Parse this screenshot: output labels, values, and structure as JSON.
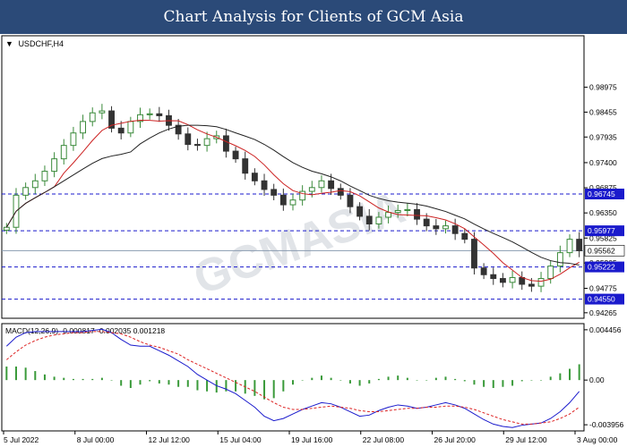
{
  "header": {
    "title": "Chart Analysis for Clients of GCM Asia"
  },
  "symbol": "USDCHF,H4",
  "watermark": "GCMASIA",
  "colors": {
    "banner": "#2b4a78",
    "bull": "#3a8a3a",
    "bear": "#333333",
    "ma_fast": "#cc2222",
    "ma_slow": "#222222",
    "level": "#1a1acc",
    "price_line": "#8a9bb0",
    "macd": "#1a1acc",
    "signal": "#dd2222",
    "hist": "#3a9a3a"
  },
  "chart_data": [
    {
      "type": "candlestick",
      "title": "USDCHF,H4",
      "ylim": [
        0.9415,
        1.0005
      ],
      "y_ticks": [
        "0.98975",
        "0.98455",
        "0.97935",
        "0.97400",
        "0.96875",
        "0.96350",
        "0.95825",
        "0.95305",
        "0.94775",
        "0.94265"
      ],
      "x_ticks": [
        "5 Jul 2022",
        "8 Jul 00:00",
        "12 Jul 12:00",
        "15 Jul 04:00",
        "19 Jul 16:00",
        "22 Jul 08:00",
        "26 Jul 20:00",
        "29 Jul 12:00",
        "3 Aug 00:00"
      ],
      "support_resistance": [
        "0.96745",
        "0.95977",
        "0.95222",
        "0.94550"
      ],
      "current_price": "0.95562",
      "series": [
        {
          "values": [
            0.9605,
            0.9672,
            0.9688,
            0.9702,
            0.9722,
            0.9748,
            0.9776,
            0.9802,
            0.9826,
            0.9844,
            0.9848,
            0.9812,
            0.9802,
            0.9826,
            0.984,
            0.9842,
            0.9838,
            0.9818,
            0.98,
            0.9778,
            0.9776,
            0.979,
            0.9796,
            0.9764,
            0.9748,
            0.9718,
            0.9702,
            0.9684,
            0.9672,
            0.9652,
            0.9662,
            0.968,
            0.9688,
            0.9702,
            0.9686,
            0.9672,
            0.9648,
            0.9628,
            0.9612,
            0.9626,
            0.9636,
            0.964,
            0.9642,
            0.9622,
            0.9608,
            0.9602,
            0.9608,
            0.9592,
            0.958,
            0.952,
            0.9506,
            0.9498,
            0.949,
            0.95,
            0.9486,
            0.9482,
            0.9498,
            0.9524,
            0.9552,
            0.958,
            0.9556
          ]
        }
      ],
      "moving_averages": [
        "fast",
        "slow"
      ]
    },
    {
      "type": "line",
      "title": "MACD(12,26,9) -0.000817 -0.002035 0.001218",
      "ylim": [
        -0.0045,
        0.005
      ],
      "y_ticks": [
        "0.004456",
        "0.00",
        "-0.003956"
      ],
      "series": [
        {
          "name": "MACD",
          "values": [
            0.003,
            0.0038,
            0.0042,
            0.0043,
            0.0043,
            0.0043,
            0.0043,
            0.0043,
            0.0043,
            0.0044,
            0.0045,
            0.0042,
            0.0036,
            0.0031,
            0.003,
            0.003,
            0.0026,
            0.0022,
            0.0017,
            0.0012,
            0.0005,
            0.0,
            -0.0005,
            -0.0008,
            -0.0012,
            -0.0018,
            -0.0024,
            -0.0032,
            -0.0036,
            -0.0034,
            -0.003,
            -0.0026,
            -0.0023,
            -0.002,
            -0.0021,
            -0.0024,
            -0.0028,
            -0.0032,
            -0.0031,
            -0.0027,
            -0.0024,
            -0.0022,
            -0.0023,
            -0.0025,
            -0.0024,
            -0.0022,
            -0.002,
            -0.0022,
            -0.0025,
            -0.003,
            -0.0035,
            -0.0039,
            -0.0041,
            -0.0042,
            -0.004,
            -0.0039,
            -0.0038,
            -0.0034,
            -0.0028,
            -0.002,
            -0.001
          ]
        },
        {
          "name": "Signal",
          "values": [
            0.0018,
            0.0025,
            0.0031,
            0.0035,
            0.0038,
            0.004,
            0.0041,
            0.0042,
            0.0042,
            0.0043,
            0.0043,
            0.0042,
            0.0041,
            0.0038,
            0.0034,
            0.0031,
            0.0029,
            0.0026,
            0.0023,
            0.0018,
            0.0014,
            0.001,
            0.0006,
            0.0002,
            -0.0002,
            -0.0006,
            -0.001,
            -0.0015,
            -0.002,
            -0.0024,
            -0.0026,
            -0.0026,
            -0.0025,
            -0.0024,
            -0.0023,
            -0.0024,
            -0.0025,
            -0.0027,
            -0.0028,
            -0.0028,
            -0.0027,
            -0.0026,
            -0.0025,
            -0.0025,
            -0.0024,
            -0.0024,
            -0.0023,
            -0.0023,
            -0.0024,
            -0.0026,
            -0.0029,
            -0.0032,
            -0.0035,
            -0.0037,
            -0.0039,
            -0.0039,
            -0.0038,
            -0.0037,
            -0.0034,
            -0.003,
            -0.0024
          ]
        },
        {
          "name": "Histogram",
          "values": [
            0.0012,
            0.0012,
            0.0011,
            0.0008,
            0.0005,
            0.0003,
            0.0002,
            0.0001,
            0.0001,
            0.0001,
            0.0002,
            0.0,
            -0.0005,
            -0.0007,
            -0.0004,
            -0.0001,
            -0.0003,
            -0.0004,
            -0.0006,
            -0.0006,
            -0.0009,
            -0.001,
            -0.0011,
            -0.001,
            -0.001,
            -0.0012,
            -0.0014,
            -0.0017,
            -0.0016,
            -0.001,
            -0.0004,
            0.0,
            0.0002,
            0.0004,
            0.0002,
            0.0,
            -0.0003,
            -0.0005,
            -0.0003,
            0.0001,
            0.0003,
            0.0004,
            0.0002,
            0.0,
            0.0,
            0.0002,
            0.0003,
            0.0001,
            -0.0001,
            -0.0004,
            -0.0006,
            -0.0007,
            -0.0006,
            -0.0005,
            -0.0001,
            0.0,
            0.0,
            0.0003,
            0.0006,
            0.001,
            0.0014
          ]
        }
      ]
    }
  ]
}
